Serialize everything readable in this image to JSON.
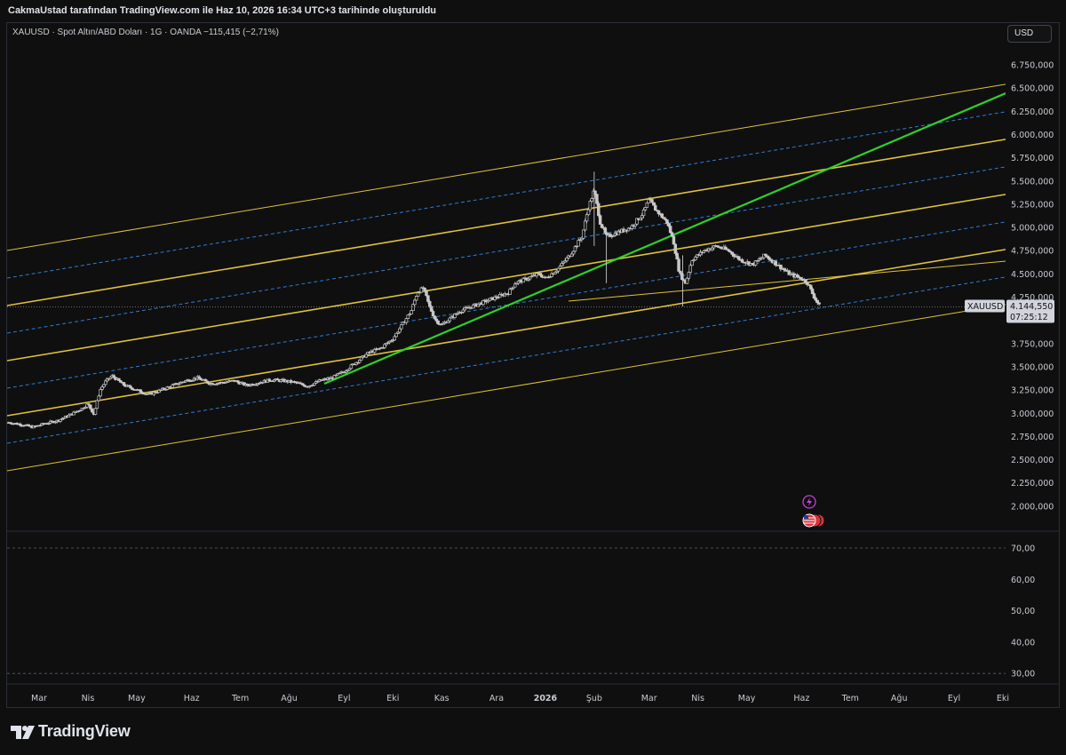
{
  "header": {
    "attribution": "CakmaUstad tarafından TradingView.com ile Haz 10, 2026 16:34 UTC+3 tarihinde oluşturuldu"
  },
  "legend": {
    "symbol_info": "XAUUSD · Spot Altın/ABD Doları · 1G · OANDA",
    "change": "−115,415 (−2,71%)"
  },
  "currency_button": "USD",
  "price_tag": {
    "symbol": "XAUUSD",
    "price": "4.144,550",
    "countdown": "07:25:12"
  },
  "footer": {
    "logo_text": "TradingView"
  },
  "colors": {
    "background": "#0f0f0f",
    "candle": "#c8c8c8",
    "channel": "#e0c13c",
    "channel_dashed": "#2e7bd6",
    "trend": "#2fd12b",
    "price_tag_bg": "#d1d4dc"
  },
  "chart_data": [
    {
      "type": "line",
      "title": "",
      "y_scale": "linear",
      "ylim": [
        1800000,
        7000000
      ],
      "y_ticks": [
        "6.750,000",
        "6.500,000",
        "6.250,000",
        "6.000,000",
        "5.750,000",
        "5.500,000",
        "5.250,000",
        "5.000,000",
        "4.750,000",
        "4.500,000",
        "4.250,000",
        "3.750,000",
        "3.500,000",
        "3.250,000",
        "3.000,000",
        "2.750,000",
        "2.500,000",
        "2.250,000",
        "2.000,000"
      ],
      "y_tick_values": [
        6750000,
        6500000,
        6250000,
        6000000,
        5750000,
        5500000,
        5250000,
        5000000,
        4750000,
        4500000,
        4250000,
        3750000,
        3500000,
        3250000,
        3000000,
        2750000,
        2500000,
        2250000,
        2000000
      ],
      "x_ticks": [
        "Mar",
        "Nis",
        "May",
        "Haz",
        "Tem",
        "Ağu",
        "Eyl",
        "Eki",
        "Kas",
        "Ara",
        "2026",
        "Şub",
        "Mar",
        "Nis",
        "May",
        "Haz",
        "Tem",
        "Ağu",
        "Eyl",
        "Eki"
      ],
      "x_tick_months": [
        2025.17,
        2025.25,
        2025.33,
        2025.42,
        2025.5,
        2025.58,
        2025.67,
        2025.75,
        2025.83,
        2025.92,
        2026.0,
        2026.08,
        2026.17,
        2026.25,
        2026.33,
        2026.42,
        2026.5,
        2026.58,
        2026.67,
        2026.75
      ],
      "series": [
        {
          "points": [
            [
              2025.12,
              2900000
            ],
            [
              2025.14,
              2880000
            ],
            [
              2025.16,
              2850000
            ],
            [
              2025.18,
              2890000
            ],
            [
              2025.2,
              2920000
            ],
            [
              2025.22,
              2980000
            ],
            [
              2025.24,
              3050000
            ],
            [
              2025.25,
              3100000
            ],
            [
              2025.26,
              2990000
            ],
            [
              2025.27,
              3250000
            ],
            [
              2025.28,
              3350000
            ],
            [
              2025.29,
              3400000
            ],
            [
              2025.31,
              3300000
            ],
            [
              2025.33,
              3250000
            ],
            [
              2025.35,
              3200000
            ],
            [
              2025.37,
              3250000
            ],
            [
              2025.39,
              3300000
            ],
            [
              2025.41,
              3350000
            ],
            [
              2025.43,
              3380000
            ],
            [
              2025.45,
              3320000
            ],
            [
              2025.47,
              3330000
            ],
            [
              2025.49,
              3350000
            ],
            [
              2025.51,
              3300000
            ],
            [
              2025.53,
              3330000
            ],
            [
              2025.55,
              3360000
            ],
            [
              2025.57,
              3350000
            ],
            [
              2025.59,
              3330000
            ],
            [
              2025.61,
              3290000
            ],
            [
              2025.63,
              3350000
            ],
            [
              2025.65,
              3380000
            ],
            [
              2025.67,
              3450000
            ],
            [
              2025.69,
              3550000
            ],
            [
              2025.71,
              3650000
            ],
            [
              2025.73,
              3700000
            ],
            [
              2025.74,
              3750000
            ],
            [
              2025.75,
              3800000
            ],
            [
              2025.76,
              3900000
            ],
            [
              2025.77,
              4000000
            ],
            [
              2025.78,
              4100000
            ],
            [
              2025.79,
              4300000
            ],
            [
              2025.8,
              4350000
            ],
            [
              2025.81,
              4150000
            ],
            [
              2025.82,
              4000000
            ],
            [
              2025.83,
              3950000
            ],
            [
              2025.85,
              4050000
            ],
            [
              2025.86,
              4100000
            ],
            [
              2025.88,
              4150000
            ],
            [
              2025.9,
              4200000
            ],
            [
              2025.92,
              4250000
            ],
            [
              2025.94,
              4300000
            ],
            [
              2025.95,
              4400000
            ],
            [
              2025.97,
              4450000
            ],
            [
              2025.99,
              4500000
            ],
            [
              2026.0,
              4450000
            ],
            [
              2026.02,
              4550000
            ],
            [
              2026.04,
              4700000
            ],
            [
              2026.06,
              4900000
            ],
            [
              2026.07,
              5200000
            ],
            [
              2026.08,
              5400000
            ],
            [
              2026.09,
              5050000
            ],
            [
              2026.1,
              4900000
            ],
            [
              2026.12,
              4950000
            ],
            [
              2026.14,
              5000000
            ],
            [
              2026.16,
              5150000
            ],
            [
              2026.17,
              5300000
            ],
            [
              2026.18,
              5200000
            ],
            [
              2026.2,
              5050000
            ],
            [
              2026.21,
              4850000
            ],
            [
              2026.22,
              4500000
            ],
            [
              2026.23,
              4400000
            ],
            [
              2026.24,
              4650000
            ],
            [
              2026.26,
              4750000
            ],
            [
              2026.28,
              4800000
            ],
            [
              2026.3,
              4750000
            ],
            [
              2026.32,
              4650000
            ],
            [
              2026.34,
              4600000
            ],
            [
              2026.36,
              4700000
            ],
            [
              2026.38,
              4600000
            ],
            [
              2026.4,
              4500000
            ],
            [
              2026.42,
              4450000
            ],
            [
              2026.43,
              4400000
            ],
            [
              2026.44,
              4260000
            ],
            [
              2026.45,
              4144550
            ]
          ]
        }
      ],
      "last_value": 4144550
    },
    {
      "type": "line",
      "title": "",
      "ylim": [
        25,
        75
      ],
      "y_ticks": [
        "70,00",
        "60,00",
        "50,00",
        "40,00",
        "30,00"
      ],
      "y_tick_values": [
        70,
        60,
        50,
        40,
        30
      ],
      "series": []
    }
  ]
}
